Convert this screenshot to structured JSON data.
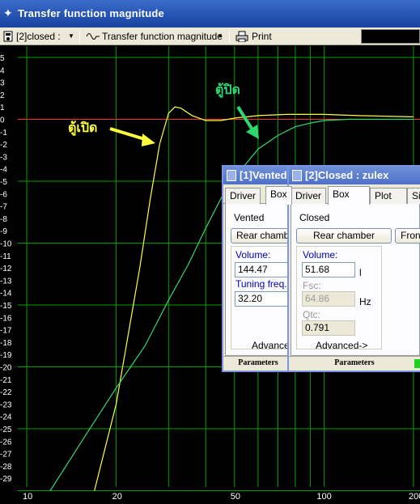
{
  "window": {
    "title": "Transfer function magnitude"
  },
  "toolbar": {
    "box_select": "[2]closed :",
    "graph_select": "Transfer function magnitude",
    "print_label": "Print"
  },
  "chart_data": {
    "type": "line",
    "xscale": "log",
    "xlim": [
      10,
      200
    ],
    "ylim": [
      -30,
      5
    ],
    "x_ticks": [
      "10",
      "20",
      "50",
      "100",
      "200"
    ],
    "y_ticks": [
      "5",
      "4",
      "3",
      "2",
      "1",
      "0",
      "-1",
      "-2",
      "-3",
      "-4",
      "-5",
      "-6",
      "-7",
      "-8",
      "-9",
      "-10",
      "-11",
      "-12",
      "-13",
      "-14",
      "-15",
      "-16",
      "-17",
      "-18",
      "-19",
      "-20",
      "-21",
      "-22",
      "-23",
      "-24",
      "-25",
      "-26",
      "-27",
      "-28",
      "-29"
    ],
    "grid": true,
    "reference_line": {
      "y": 0,
      "color": "#ff3030"
    },
    "series": [
      {
        "color": "#ffff40",
        "x": [
          16.9,
          20,
          24,
          26,
          28,
          30,
          31.5,
          33,
          36,
          40,
          45,
          50,
          60,
          75,
          100,
          130,
          200
        ],
        "y": [
          -30,
          -23,
          -12,
          -6.5,
          -2,
          0.5,
          1,
          0.9,
          0.3,
          -0.1,
          -0.1,
          0.1,
          0.3,
          0.4,
          0.4,
          0.3,
          0.2
        ]
      },
      {
        "color": "#2ed870",
        "x": [
          12,
          16,
          20,
          25,
          30,
          35,
          40,
          45,
          50,
          55,
          60,
          70,
          80,
          90,
          100,
          120,
          150,
          200
        ],
        "y": [
          -30,
          -25.3,
          -21.7,
          -18.3,
          -14.6,
          -11.7,
          -8.8,
          -6.4,
          -4.7,
          -3.5,
          -2.4,
          -1.3,
          -0.6,
          -0.3,
          -0.1,
          0,
          0,
          0
        ]
      }
    ],
    "annotations": [
      {
        "text": "ตู้เปิด",
        "color": "#ffff40"
      },
      {
        "text": "ตู้ปิด",
        "color": "#2ed870"
      }
    ]
  },
  "vented": {
    "title": "[1]Vented",
    "tabs": [
      "Driver",
      "Box"
    ],
    "type_label": "Vented",
    "rear_button": "Rear chamber",
    "volume_label": "Volume:",
    "volume_value": "144.47",
    "tuning_label": "Tuning freq.:",
    "tuning_value": "32.20",
    "advanced": "Advanced->",
    "status": "Parameters"
  },
  "closed": {
    "title": "[2]Closed : zulex",
    "tabs": [
      "Driver",
      "Box",
      "Plot",
      "Si"
    ],
    "type_label": "Closed",
    "rear_button": "Rear chamber",
    "front_button": "Front",
    "volume_label": "Volume:",
    "volume_value": "51.68",
    "volume_unit": "l",
    "fsc_label": "Fsc:",
    "fsc_value": "64.86",
    "fsc_unit": "Hz",
    "qtc_label": "Qtc:",
    "qtc_value": "0.791",
    "advanced": "Advanced->",
    "status": "Parameters"
  }
}
